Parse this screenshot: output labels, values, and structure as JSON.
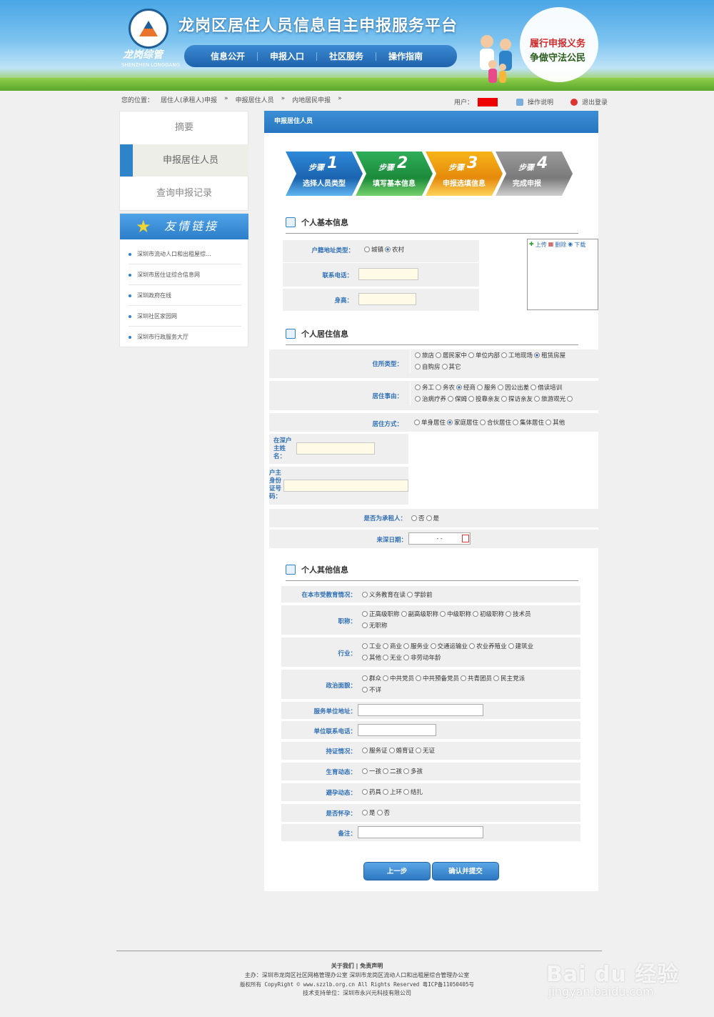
{
  "header": {
    "site_title": "龙岗区居住人员信息自主申报服务平台",
    "logo_text": "龙岗综管",
    "logo_sub": "SHENZHEN LONGGANG",
    "nav": [
      "信息公开",
      "申报入口",
      "社区服务",
      "操作指南"
    ],
    "slogan_1": "履行申报义务",
    "slogan_2": "争做守法公民"
  },
  "breadcrumb": {
    "label": "您的位置：",
    "items": [
      "居住人(承租人)申报",
      "»",
      "申报居住人员",
      "»",
      "内地居民申报",
      "»"
    ]
  },
  "user_area": {
    "user_label": "用户：",
    "help": "操作说明",
    "logout": "退出登录"
  },
  "sidebar": {
    "items": [
      "摘要",
      "申报居住人员",
      "查询申报记录"
    ],
    "links_title": "友情链接",
    "links": [
      "深圳市流动人口和出租屋综...",
      "深圳市居住证综合信息网",
      "深圳政府在线",
      "深圳社区家园网",
      "深圳市行政服务大厅"
    ]
  },
  "main": {
    "title": "申报居住人员",
    "steps": [
      {
        "t": "步骤",
        "n": "1",
        "label": "选择人员类型"
      },
      {
        "t": "步骤",
        "n": "2",
        "label": "填写基本信息"
      },
      {
        "t": "步骤",
        "n": "3",
        "label": "申报选填信息"
      },
      {
        "t": "步骤",
        "n": "4",
        "label": "完成申报"
      }
    ],
    "sec1": "个人基本信息",
    "sec2": "个人居住信息",
    "sec3": "个人其他信息",
    "upload": [
      "上传",
      "删除",
      "下载"
    ],
    "hukou_label": "户籍地址类型：",
    "hukou_opts": [
      "城镇",
      "农村"
    ],
    "phone_label": "联系电话：",
    "height_label": "身高：",
    "zhusuo_label": "住所类型：",
    "zhusuo_line1": [
      "旅店",
      "居民家中",
      "单位内部",
      "工地现场",
      "租赁房屋"
    ],
    "zhusuo_line2": [
      "自购房",
      "其它"
    ],
    "shiyou_label": "居住事由：",
    "shiyou_line1": [
      "务工",
      "务农",
      "经商",
      "服务",
      "因公出差",
      "借读培训"
    ],
    "shiyou_line2": [
      "治病疗养",
      "保姆",
      "投靠亲友",
      "探访亲友",
      "旅游观光"
    ],
    "fangshi_label": "居住方式：",
    "fangshi_opts": [
      "单身居住",
      "家庭居住",
      "合伙居住",
      "集体居住",
      "其他"
    ],
    "huzhu_name_label": "在深户主姓名：",
    "huzhu_id_label": "户主身份证号码：",
    "chengzu_label": "是否为承租人：",
    "chengzu_opts": [
      "否",
      "是"
    ],
    "laishen_label": "来深日期：",
    "laishen_value": "-  -",
    "edu_label": "在本市受教育情况：",
    "edu_opts": [
      "义务教育在读",
      "学龄前"
    ],
    "zhicheng_label": "职称：",
    "zhicheng_line1": [
      "正高级职称",
      "副高级职称",
      "中级职称",
      "初级职称",
      "技术员"
    ],
    "zhicheng_line2": [
      "无职称"
    ],
    "hangye_label": "行业：",
    "hangye_line1": [
      "工业",
      "商业",
      "服务业",
      "交通运输业",
      "农业养殖业",
      "建筑业"
    ],
    "hangye_line2": [
      "其他",
      "无业",
      "非劳动年龄"
    ],
    "zhengzhi_label": "政治面貌：",
    "zhengzhi_line1": [
      "群众",
      "中共党员",
      "中共预备党员",
      "共青团员",
      "民主党派"
    ],
    "zhengzhi_line2": [
      "不详"
    ],
    "fuwu_addr_label": "服务单位地址：",
    "danwei_phone_label": "单位联系电话：",
    "chizheng_label": "持证情况：",
    "chizheng_opts": [
      "服务证",
      "婚育证",
      "无证"
    ],
    "shengyu_label": "生育动态：",
    "shengyu_opts": [
      "一孩",
      "二孩",
      "多孩"
    ],
    "biyun_label": "避孕动态：",
    "biyun_opts": [
      "药具",
      "上环",
      "结扎"
    ],
    "huaiyun_label": "是否怀孕：",
    "huaiyun_opts": [
      "是",
      "否"
    ],
    "beizhu_label": "备注：",
    "btn_prev": "上一步",
    "btn_submit": "确认并提交"
  },
  "footer": {
    "links": "关于我们 | 免责声明",
    "line1": "主办：深圳市龙岗区社区网格管理办公室 深圳市龙岗区流动人口和出租屋综合管理办公室",
    "line2": "版权所有 CopyRight © www.szzlb.org.cn All Rights Reserved 粤ICP备11050405号",
    "line3": "技术支持单位：深圳市永兴元科技有限公司"
  },
  "watermark": {
    "brand": "Bai du 经验",
    "url": "jingyan.baidu.com"
  }
}
